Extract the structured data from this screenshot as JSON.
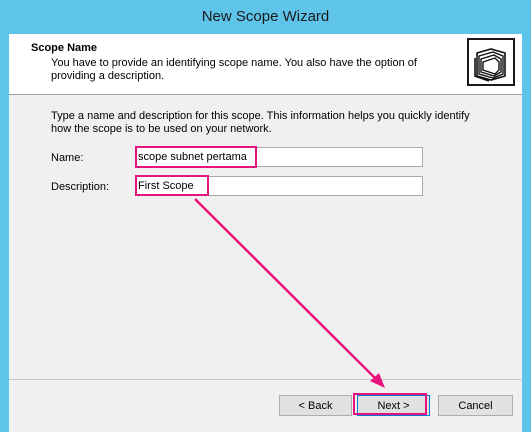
{
  "window": {
    "title": "New Scope Wizard"
  },
  "header": {
    "title": "Scope Name",
    "description": "You have to provide an identifying scope name. You also have the option of providing a description."
  },
  "main": {
    "instructions": "Type a name and description for this scope. This information helps you quickly identify how the scope is to be used on your network.",
    "name_label": "Name:",
    "name_value": "scope subnet pertama",
    "description_label": "Description:",
    "description_value": "First Scope"
  },
  "footer": {
    "back_label": "< Back",
    "next_label": "Next >",
    "cancel_label": "Cancel"
  },
  "colors": {
    "titlebar": "#5ec4ea",
    "annotation": "#e6137a",
    "dialog_bg": "#f0f0f0"
  },
  "icons": {
    "wizard": "folders-icon"
  }
}
